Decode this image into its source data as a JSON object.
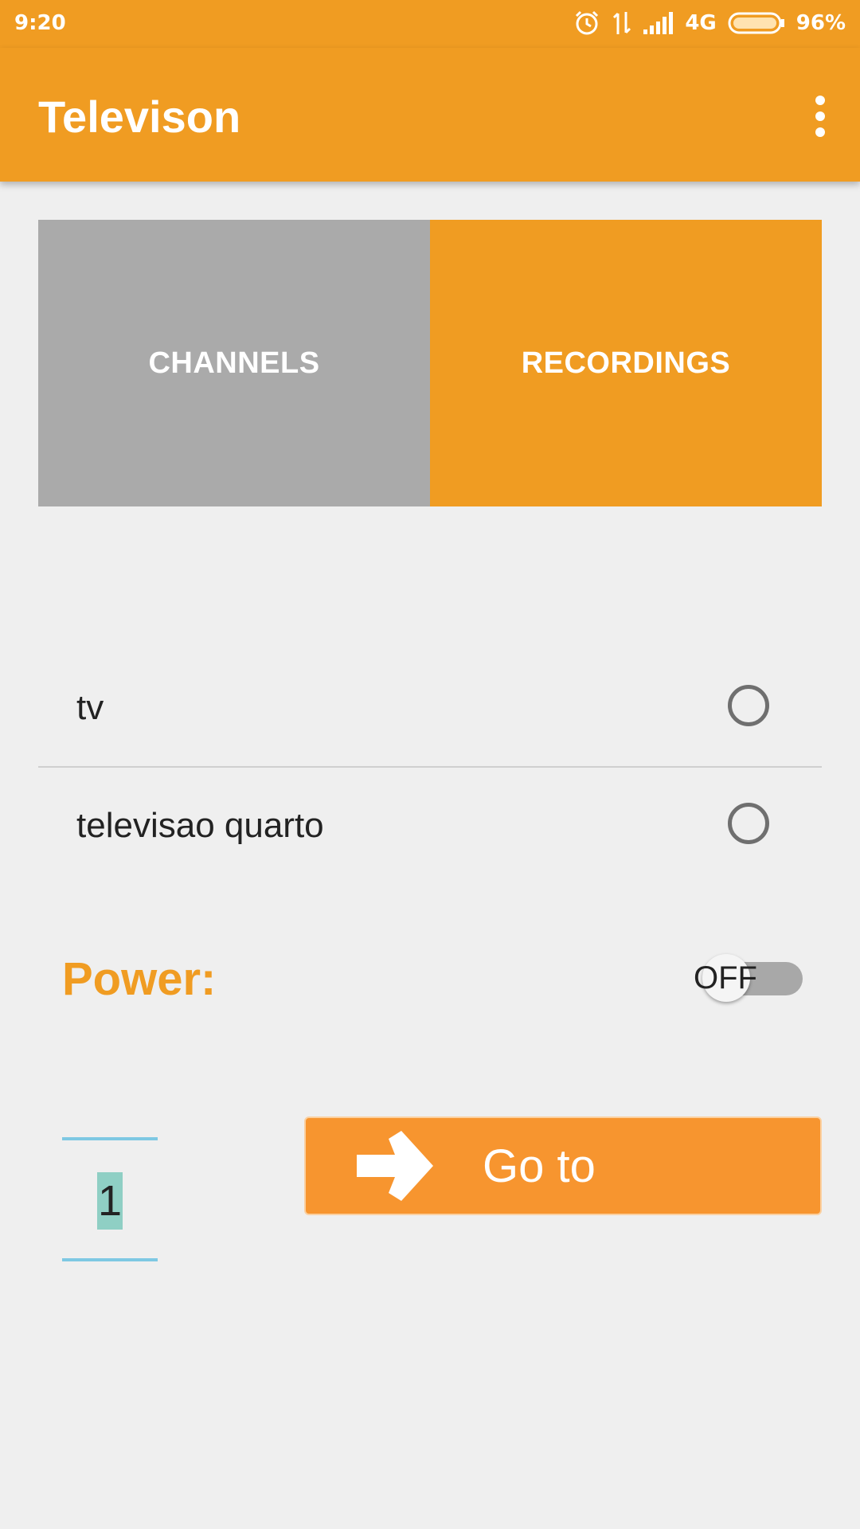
{
  "status_bar": {
    "time": "9:20",
    "network": "4G",
    "battery": "96%"
  },
  "app_bar": {
    "title": "Televison",
    "menu_icon": "more-vert-icon"
  },
  "tabs": [
    {
      "label": "CHANNELS"
    },
    {
      "label": "RECORDINGS"
    }
  ],
  "devices": [
    {
      "name": "tv"
    },
    {
      "name": "televisao quarto"
    }
  ],
  "power": {
    "label": "Power:",
    "state": "OFF"
  },
  "channel_input": {
    "value": "1"
  },
  "goto_button": {
    "label": "Go to"
  },
  "colors": {
    "accent": "#f09c22",
    "tab_inactive": "#aaaaaa",
    "background": "#efefef"
  }
}
